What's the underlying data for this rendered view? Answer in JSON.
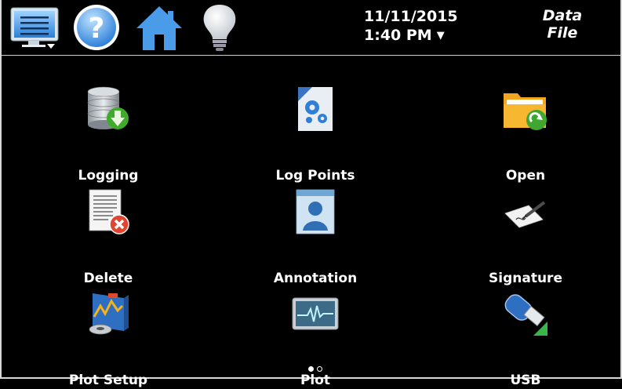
{
  "header": {
    "menu_icon": "monitor-menu-icon",
    "help_icon": "help-icon",
    "home_icon": "home-icon",
    "light_icon": "lightbulb-icon",
    "date": "11/11/2015",
    "time": "1:40 PM",
    "time_caret": "▼",
    "title_line1": "Data",
    "title_line2": "File"
  },
  "tiles": [
    {
      "label": "Logging",
      "icon": "database-download-icon"
    },
    {
      "label": "Log Points",
      "icon": "gear-document-icon"
    },
    {
      "label": "Open",
      "icon": "folder-open-icon"
    },
    {
      "label": "Delete",
      "icon": "document-delete-icon"
    },
    {
      "label": "Annotation",
      "icon": "text-person-icon"
    },
    {
      "label": "Signature",
      "icon": "signature-pen-icon"
    },
    {
      "label": "Plot Setup",
      "icon": "plot-setup-icon"
    },
    {
      "label": "Plot",
      "icon": "waveform-monitor-icon"
    },
    {
      "label": "USB",
      "icon": "usb-drive-icon"
    }
  ],
  "pager": {
    "pages": 2,
    "current": 1
  },
  "colors": {
    "background": "#000000",
    "text": "#ffffff",
    "accent_blue": "#2f8be6"
  }
}
